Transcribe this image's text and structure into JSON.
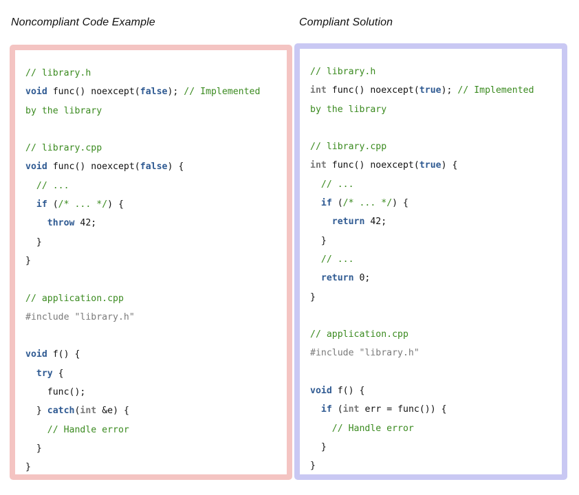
{
  "colors": {
    "noncompliant_border": "#f4c4c2",
    "compliant_border": "#c9c8f3",
    "comment": "#3a8a1f",
    "keyword": "#2f5a92",
    "type": "#777777",
    "preprocessor": "#7a7a7a",
    "plain": "#111111"
  },
  "panels": [
    {
      "id": "noncompliant",
      "heading": "Noncompliant Code Example",
      "lines": [
        [
          {
            "t": "comment",
            "v": "// library.h"
          }
        ],
        [
          {
            "t": "keyword",
            "v": "void"
          },
          {
            "t": "plain",
            "v": " func() noexcept("
          },
          {
            "t": "keyword",
            "v": "false"
          },
          {
            "t": "plain",
            "v": "); "
          },
          {
            "t": "comment",
            "v": "// Implemented"
          }
        ],
        [
          {
            "t": "comment",
            "v": "by the library"
          }
        ],
        [],
        [
          {
            "t": "comment",
            "v": "// library.cpp"
          }
        ],
        [
          {
            "t": "keyword",
            "v": "void"
          },
          {
            "t": "plain",
            "v": " func() noexcept("
          },
          {
            "t": "keyword",
            "v": "false"
          },
          {
            "t": "plain",
            "v": ") {"
          }
        ],
        [
          {
            "t": "plain",
            "v": "  "
          },
          {
            "t": "comment",
            "v": "// ..."
          }
        ],
        [
          {
            "t": "plain",
            "v": "  "
          },
          {
            "t": "keyword",
            "v": "if"
          },
          {
            "t": "plain",
            "v": " ("
          },
          {
            "t": "comment",
            "v": "/* ... */"
          },
          {
            "t": "plain",
            "v": ") {"
          }
        ],
        [
          {
            "t": "plain",
            "v": "    "
          },
          {
            "t": "keyword",
            "v": "throw"
          },
          {
            "t": "plain",
            "v": " 42;"
          }
        ],
        [
          {
            "t": "plain",
            "v": "  }"
          }
        ],
        [
          {
            "t": "plain",
            "v": "}"
          }
        ],
        [],
        [
          {
            "t": "comment",
            "v": "// application.cpp"
          }
        ],
        [
          {
            "t": "pre",
            "v": "#include \"library.h\""
          }
        ],
        [],
        [
          {
            "t": "keyword",
            "v": "void"
          },
          {
            "t": "plain",
            "v": " f() {"
          }
        ],
        [
          {
            "t": "plain",
            "v": "  "
          },
          {
            "t": "keyword",
            "v": "try"
          },
          {
            "t": "plain",
            "v": " {"
          }
        ],
        [
          {
            "t": "plain",
            "v": "    func();"
          }
        ],
        [
          {
            "t": "plain",
            "v": "  } "
          },
          {
            "t": "keyword",
            "v": "catch"
          },
          {
            "t": "plain",
            "v": "("
          },
          {
            "t": "type",
            "v": "int"
          },
          {
            "t": "plain",
            "v": " &e) {"
          }
        ],
        [
          {
            "t": "plain",
            "v": "    "
          },
          {
            "t": "comment",
            "v": "// Handle error"
          }
        ],
        [
          {
            "t": "plain",
            "v": "  }"
          }
        ],
        [
          {
            "t": "plain",
            "v": "}"
          }
        ]
      ]
    },
    {
      "id": "compliant",
      "heading": "Compliant Solution",
      "lines": [
        [
          {
            "t": "comment",
            "v": "// library.h"
          }
        ],
        [
          {
            "t": "type",
            "v": "int"
          },
          {
            "t": "plain",
            "v": " func() noexcept("
          },
          {
            "t": "keyword",
            "v": "true"
          },
          {
            "t": "plain",
            "v": "); "
          },
          {
            "t": "comment",
            "v": "// Implemented"
          }
        ],
        [
          {
            "t": "comment",
            "v": "by the library"
          }
        ],
        [],
        [
          {
            "t": "comment",
            "v": "// library.cpp"
          }
        ],
        [
          {
            "t": "type",
            "v": "int"
          },
          {
            "t": "plain",
            "v": " func() noexcept("
          },
          {
            "t": "keyword",
            "v": "true"
          },
          {
            "t": "plain",
            "v": ") {"
          }
        ],
        [
          {
            "t": "plain",
            "v": "  "
          },
          {
            "t": "comment",
            "v": "// ..."
          }
        ],
        [
          {
            "t": "plain",
            "v": "  "
          },
          {
            "t": "keyword",
            "v": "if"
          },
          {
            "t": "plain",
            "v": " ("
          },
          {
            "t": "comment",
            "v": "/* ... */"
          },
          {
            "t": "plain",
            "v": ") {"
          }
        ],
        [
          {
            "t": "plain",
            "v": "    "
          },
          {
            "t": "keyword",
            "v": "return"
          },
          {
            "t": "plain",
            "v": " 42;"
          }
        ],
        [
          {
            "t": "plain",
            "v": "  }"
          }
        ],
        [
          {
            "t": "plain",
            "v": "  "
          },
          {
            "t": "comment",
            "v": "// ..."
          }
        ],
        [
          {
            "t": "plain",
            "v": "  "
          },
          {
            "t": "keyword",
            "v": "return"
          },
          {
            "t": "plain",
            "v": " 0;"
          }
        ],
        [
          {
            "t": "plain",
            "v": "}"
          }
        ],
        [],
        [
          {
            "t": "comment",
            "v": "// application.cpp"
          }
        ],
        [
          {
            "t": "pre",
            "v": "#include \"library.h\""
          }
        ],
        [],
        [
          {
            "t": "keyword",
            "v": "void"
          },
          {
            "t": "plain",
            "v": " f() {"
          }
        ],
        [
          {
            "t": "plain",
            "v": "  "
          },
          {
            "t": "keyword",
            "v": "if"
          },
          {
            "t": "plain",
            "v": " ("
          },
          {
            "t": "type",
            "v": "int"
          },
          {
            "t": "plain",
            "v": " err = func()) {"
          }
        ],
        [
          {
            "t": "plain",
            "v": "    "
          },
          {
            "t": "comment",
            "v": "// Handle error"
          }
        ],
        [
          {
            "t": "plain",
            "v": "  }"
          }
        ],
        [
          {
            "t": "plain",
            "v": "}"
          }
        ]
      ]
    }
  ]
}
